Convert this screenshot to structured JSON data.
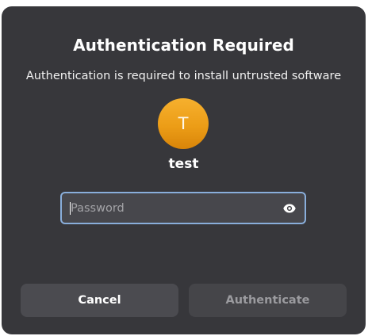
{
  "dialog": {
    "title": "Authentication Required",
    "message": "Authentication is required to install untrusted software"
  },
  "user": {
    "avatar_initial": "T",
    "name": "test",
    "avatar_color": "#ec9d17"
  },
  "password": {
    "value": "",
    "placeholder": "Password",
    "reveal_icon": "eye-icon"
  },
  "buttons": {
    "cancel_label": "Cancel",
    "authenticate_label": "Authenticate"
  },
  "colors": {
    "dialog_background": "#37373b",
    "focus_border": "#89aedb"
  }
}
